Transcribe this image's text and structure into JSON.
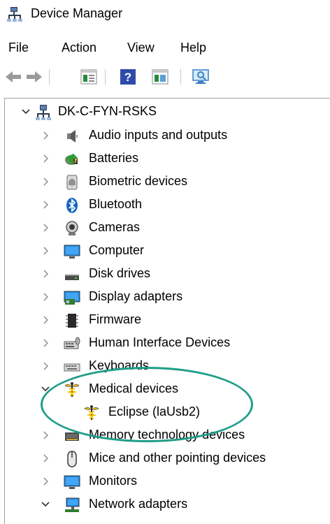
{
  "window": {
    "title": "Device Manager"
  },
  "menu": [
    "File",
    "Action",
    "View",
    "Help"
  ],
  "toolbar": {
    "buttons": [
      {
        "name": "back-icon"
      },
      {
        "name": "forward-icon"
      },
      {
        "name": "properties-icon"
      },
      {
        "name": "help-icon"
      },
      {
        "name": "update-driver-icon"
      },
      {
        "name": "scan-hardware-icon"
      }
    ]
  },
  "tree": {
    "root": {
      "label": "DK-C-FYN-RSKS",
      "expanded": true
    },
    "categories": [
      {
        "label": "Audio inputs and outputs",
        "icon": "speaker-icon",
        "expanded": false
      },
      {
        "label": "Batteries",
        "icon": "battery-icon",
        "expanded": false
      },
      {
        "label": "Biometric devices",
        "icon": "fingerprint-icon",
        "expanded": false
      },
      {
        "label": "Bluetooth",
        "icon": "bluetooth-icon",
        "expanded": false
      },
      {
        "label": "Cameras",
        "icon": "camera-icon",
        "expanded": false
      },
      {
        "label": "Computer",
        "icon": "computer-icon",
        "expanded": false
      },
      {
        "label": "Disk drives",
        "icon": "disk-drive-icon",
        "expanded": false
      },
      {
        "label": "Display adapters",
        "icon": "display-adapter-icon",
        "expanded": false
      },
      {
        "label": "Firmware",
        "icon": "firmware-icon",
        "expanded": false
      },
      {
        "label": "Human Interface Devices",
        "icon": "hid-icon",
        "expanded": false
      },
      {
        "label": "Keyboards",
        "icon": "keyboard-icon",
        "expanded": false
      },
      {
        "label": "Medical devices",
        "icon": "medical-icon",
        "expanded": true
      },
      {
        "label": "Eclipse (laUsb2)",
        "icon": "medical-icon",
        "child": true
      },
      {
        "label": "Memory technology devices",
        "icon": "memory-icon",
        "expanded": false
      },
      {
        "label": "Mice and other pointing devices",
        "icon": "mouse-icon",
        "expanded": false
      },
      {
        "label": "Monitors",
        "icon": "monitor-icon",
        "expanded": false
      },
      {
        "label": "Network adapters",
        "icon": "network-adapter-icon",
        "expanded": true
      }
    ]
  },
  "colors": {
    "annotation": "#1f9e87"
  }
}
